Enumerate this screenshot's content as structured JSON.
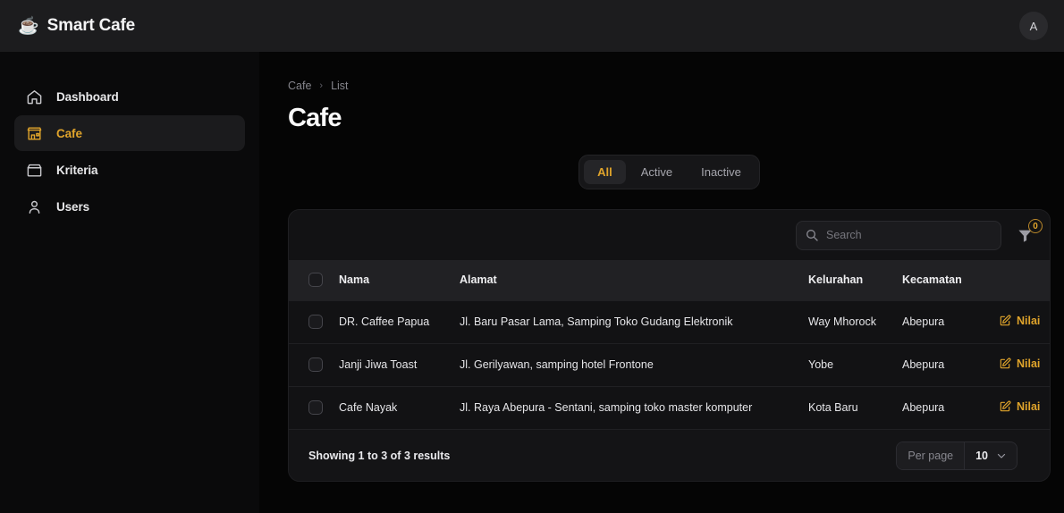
{
  "topbar": {
    "logo_icon": "coffee-cup-icon",
    "brand_name": "Smart Cafe",
    "avatar_initial": "A"
  },
  "sidebar": {
    "items": [
      {
        "label": "Dashboard",
        "icon": "home-icon",
        "active": false
      },
      {
        "label": "Cafe",
        "icon": "store-icon",
        "active": true
      },
      {
        "label": "Kriteria",
        "icon": "box-icon",
        "active": false
      },
      {
        "label": "Users",
        "icon": "user-icon",
        "active": false
      }
    ]
  },
  "main": {
    "breadcrumb": {
      "parent": "Cafe",
      "separator": "›",
      "current": "List"
    },
    "page_title": "Cafe",
    "tabs": [
      {
        "label": "All",
        "active": true
      },
      {
        "label": "Active",
        "active": false
      },
      {
        "label": "Inactive",
        "active": false
      }
    ],
    "toolbar": {
      "search_placeholder": "Search",
      "search_value": "",
      "search_icon": "search-icon",
      "filter_icon": "filter-funnel-icon",
      "filter_badge_count": "0"
    },
    "table": {
      "columns": [
        "Nama",
        "Alamat",
        "Kelurahan",
        "Kecamatan"
      ],
      "action_label": "Nilai",
      "action_icon": "edit-square-pen-icon",
      "rows": [
        {
          "nama": "DR. Caffee Papua",
          "alamat": "Jl. Baru Pasar Lama, Samping Toko Gudang Elektronik",
          "kelurahan": "Way Mhorock",
          "kecamatan": "Abepura",
          "action": "Nilai"
        },
        {
          "nama": "Janji Jiwa Toast",
          "alamat": "Jl. Gerilyawan, samping hotel Frontone",
          "kelurahan": "Yobe",
          "kecamatan": "Abepura",
          "action": "Nilai"
        },
        {
          "nama": "Cafe Nayak",
          "alamat": "Jl. Raya Abepura - Sentani, samping toko master komputer",
          "kelurahan": "Kota Baru",
          "kecamatan": "Abepura",
          "action": "Nilai"
        }
      ]
    },
    "footer": {
      "showing_text": "Showing 1 to 3 of 3 results",
      "per_page_label": "Per page",
      "per_page_value": "10",
      "chevron_icon": "chevron-down-icon"
    }
  },
  "colors": {
    "accent": "#e0a42b",
    "page_bg": "#050505",
    "topbar_bg": "#1c1c1e",
    "sidebar_bg": "#0a0a0b",
    "card_bg": "#141416",
    "table_header_bg": "#212124"
  }
}
